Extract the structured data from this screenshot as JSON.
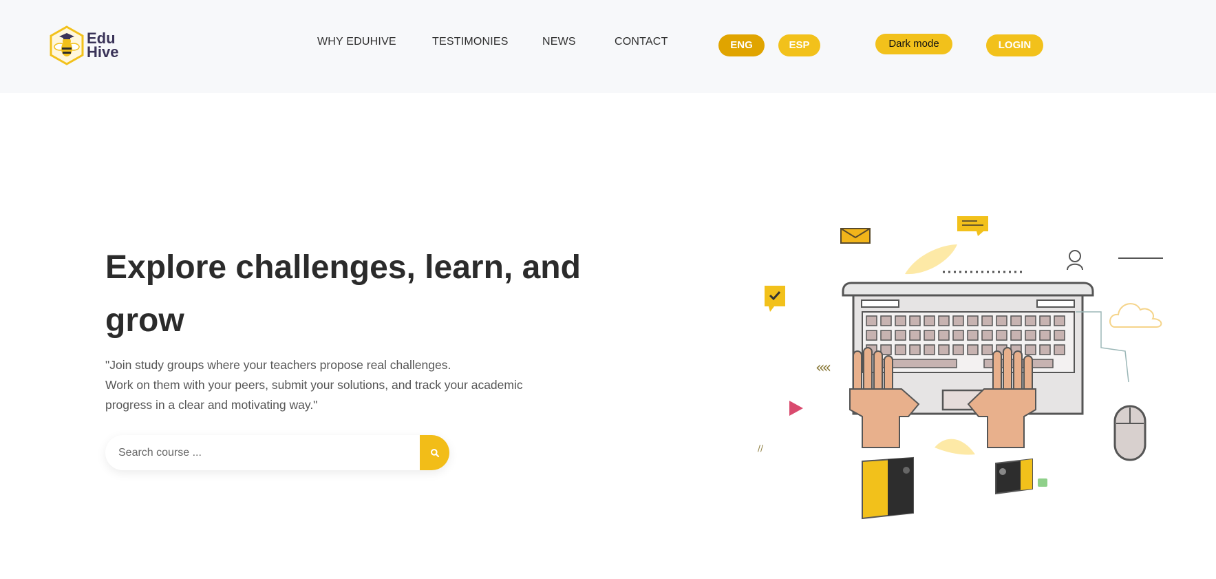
{
  "brand": {
    "line1": "Edu",
    "line2": "Hive"
  },
  "nav": {
    "why": "WHY EDUHIVE",
    "testimonies": "TESTIMONIES",
    "news": "NEWS",
    "contact": "CONTACT"
  },
  "lang": {
    "eng": "ENG",
    "esp": "ESP",
    "active": "ENG"
  },
  "actions": {
    "dark_mode": "Dark mode",
    "login": "LOGIN"
  },
  "hero": {
    "title_line1": "Explore challenges, learn, and",
    "title_line2": "grow",
    "desc_line1": "\"Join study groups where your teachers propose real challenges.",
    "desc_line2": "Work on them with your peers, submit your solutions, and track your academic",
    "desc_line3": "progress in a clear and motivating way.\""
  },
  "search": {
    "placeholder": "Search course ...",
    "value": ""
  },
  "icons": {
    "logo": "bee-graduation-cap-logo",
    "search": "search-icon"
  },
  "colors": {
    "accent": "#f2c11b",
    "accent_active": "#e0a400",
    "header_bg": "#f7f8fa",
    "title": "#2b2b2b",
    "brand_text": "#3a3358"
  }
}
